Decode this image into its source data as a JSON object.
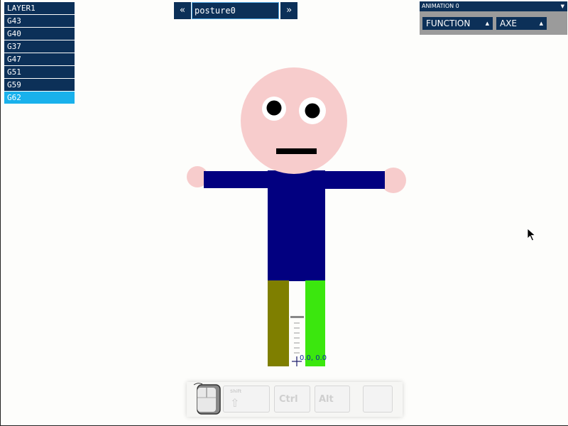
{
  "layers": {
    "items": [
      {
        "label": "LAYER1"
      },
      {
        "label": "G43"
      },
      {
        "label": "G40"
      },
      {
        "label": "G37"
      },
      {
        "label": "G47"
      },
      {
        "label": "G51"
      },
      {
        "label": "G59"
      },
      {
        "label": "G62"
      }
    ],
    "selected": "G62"
  },
  "posture_nav": {
    "prev_label": "«",
    "next_label": "»",
    "current_value": "posture0"
  },
  "animation_panel": {
    "animation_label": "ANIMATION 0",
    "function_label": "FUNCTION",
    "axe_label": "AXE"
  },
  "canvas": {
    "coordinate_readout": "0.0, 0.0"
  },
  "input_indicator": {
    "shift_label": "Shift",
    "shift_glyph": "⇧",
    "ctrl_label": "Ctrl",
    "alt_label": "Alt"
  },
  "colors": {
    "head": "#f7cccc",
    "body": "#020080",
    "left_leg": "#7f7f00",
    "right_leg": "#3be70e",
    "panel": "#0c3058",
    "selected_layer": "#19b1ec"
  }
}
